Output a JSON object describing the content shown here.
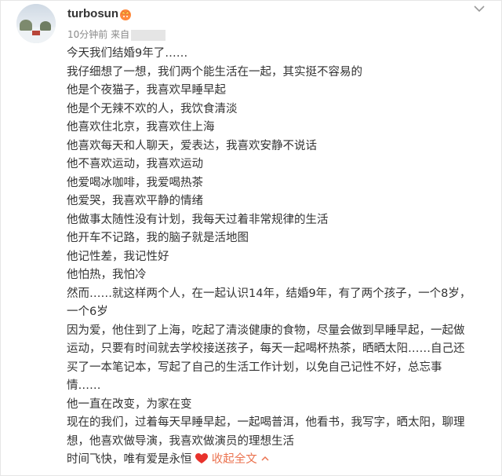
{
  "author": {
    "name": "turbosun",
    "badge_icon": "crown-badge-icon"
  },
  "meta": {
    "time": "10分钟前",
    "source_prefix": "来自"
  },
  "post": {
    "lines": [
      "今天我们结婚9年了……",
      "我仔细想了一想，我们两个能生活在一起，其实挺不容易的",
      "他是个夜猫子，我喜欢早睡早起",
      "他是个无辣不欢的人，我饮食清淡",
      "他喜欢住北京，我喜欢住上海",
      "他喜欢每天和人聊天，爱表达，我喜欢安静不说话",
      "他不喜欢运动，我喜欢运动",
      "他爱喝冰咖啡，我爱喝热茶",
      "他爱哭，我喜欢平静的情绪",
      "他做事太随性没有计划，我每天过着非常规律的生活",
      "他开车不记路，我的脑子就是活地图",
      "他记性差，我记性好",
      "他怕热，我怕冷",
      "然而……就这样两个人，在一起认识14年，结婚9年，有了两个孩子，一个8岁，",
      "一个6岁",
      "因为爱，他住到了上海，吃起了清淡健康的食物，尽量会做到早睡早起，一起做",
      "运动，只要有时间就去学校接送孩子，每天一起喝杯热茶，晒晒太阳……自己还",
      "买了一本笔记本，写起了自己的生活工作计划，以免自己记性不好，总忘事",
      "情……",
      "他一直在改变，为家在变",
      "现在的我们，过着每天早睡早起，一起喝普洱，他看书，我写字，晒太阳，聊理",
      "想，他喜欢做导演，我喜欢做演员的理想生活"
    ],
    "last_line": "时间飞快，唯有爱是永恒",
    "collapse_label": "收起全文"
  },
  "colors": {
    "text": "#333333",
    "meta": "#8a8a8a",
    "link": "#eb7350",
    "heart": "#e8322c"
  }
}
